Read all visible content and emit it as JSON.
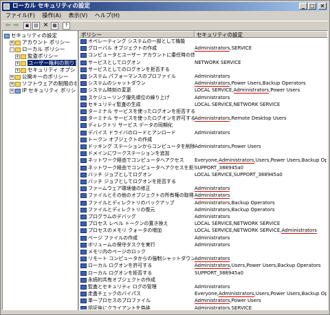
{
  "window": {
    "title": "ローカル セキュリティの設定"
  },
  "menu": [
    "ファイル(F)",
    "操作(A)",
    "表示(V)",
    "ヘルプ(H)"
  ],
  "tree": [
    {
      "label": "セキュリティの設定",
      "level": 0,
      "exp": "",
      "icon": "shield"
    },
    {
      "label": "アカウント ポリシー",
      "level": 1,
      "exp": "+",
      "icon": "folder"
    },
    {
      "label": "ローカル ポリシー",
      "level": 1,
      "exp": "-",
      "icon": "folder"
    },
    {
      "label": "監査ポリシー",
      "level": 2,
      "exp": "+",
      "icon": "folder"
    },
    {
      "label": "ユーザー権利の割り当て",
      "level": 2,
      "exp": "+",
      "icon": "folder",
      "selected": true
    },
    {
      "label": "セキュリティ オプション",
      "level": 2,
      "exp": "+",
      "icon": "folder"
    },
    {
      "label": "公開キーのポリシー",
      "level": 1,
      "exp": "+",
      "icon": "folder"
    },
    {
      "label": "ソフトウェアの制限のポリシー",
      "level": 1,
      "exp": "+",
      "icon": "folder"
    },
    {
      "label": "IP セキュリティ ポリシー (ロー",
      "level": 1,
      "exp": "+",
      "icon": "shield"
    }
  ],
  "columns": {
    "policy": "ポリシー",
    "setting": "セキュリティの設定"
  },
  "rows": [
    {
      "policy": "オペレーティング システムの一部として機能",
      "pre": "",
      "ul": "",
      "post": ""
    },
    {
      "policy": "グローバル オブジェクトの作成",
      "pre": "",
      "ul": "Administrators",
      "post": ",SERVICE"
    },
    {
      "policy": "コンピュータとユーザー アカウントに委任時の信頼を付与",
      "pre": "",
      "ul": "",
      "post": ""
    },
    {
      "policy": "サービスとしてログオン",
      "pre": "NETWORK SERVICE",
      "ul": "",
      "post": ""
    },
    {
      "policy": "サービスとしてのログオンを拒否する",
      "pre": "",
      "ul": "",
      "post": ""
    },
    {
      "policy": "システム パフォーマンスのプロファイル",
      "pre": "",
      "ul": "Administrators",
      "post": ""
    },
    {
      "policy": "システムのシャットダウン",
      "pre": "",
      "ul": "Administrators",
      "post": ",Power Users,Backup Operators"
    },
    {
      "policy": "システム時刻の変更",
      "pre": "LOCAL SERVICE,",
      "ul": "Administrators",
      "post": ",Power Users"
    },
    {
      "policy": "スケジューリング優先順位の繰り上げ",
      "pre": "",
      "ul": "Administrators",
      "post": ""
    },
    {
      "policy": "セキュリティ監査の生成",
      "pre": "LOCAL SERVICE,NETWORK SERVICE",
      "ul": "",
      "post": ""
    },
    {
      "policy": "ターミナル サービスを使ったログオンを拒否する",
      "pre": "",
      "ul": "",
      "post": ""
    },
    {
      "policy": "ターミナル サービスを使ったログオンを許可する",
      "pre": "",
      "ul": "Administrators",
      "post": ",Remote Desktop Users"
    },
    {
      "policy": "ディレクトリ サービス データの同期化",
      "pre": "",
      "ul": "",
      "post": ""
    },
    {
      "policy": "デバイス ドライバのロードとアンロード",
      "pre": "",
      "ul": "Administrators",
      "post": ""
    },
    {
      "policy": "トークン オブジェクトの作成",
      "pre": "",
      "ul": "",
      "post": ""
    },
    {
      "policy": "ドッキング ステーションからコンピュータを削除",
      "pre": "",
      "ul": "Administrators",
      "post": ",Power Users"
    },
    {
      "policy": "ドメインにワークステーションを追加",
      "pre": "",
      "ul": "",
      "post": ""
    },
    {
      "policy": "ネットワーク経由でコンピュータへアクセス",
      "pre": "Everyone,",
      "ul": "Administrators",
      "post": ",Users,Power Users,Backup Operators"
    },
    {
      "policy": "ネットワーク経由でコンピュータへアクセスを拒否する",
      "pre": "SUPPORT_388945a0",
      "ul": "",
      "post": ""
    },
    {
      "policy": "バッチ ジョブとしてログオン",
      "pre": "LOCAL SERVICE,SUPPORT_388945a0",
      "ul": "",
      "post": ""
    },
    {
      "policy": "バッチ ジョブとしてログオンを拒否する",
      "pre": "",
      "ul": "",
      "post": ""
    },
    {
      "policy": "ファームウェア環境値の修正",
      "pre": "",
      "ul": "Administrators",
      "post": ""
    },
    {
      "policy": "ファイルとその他のオブジェクトの所有権の取得",
      "pre": "",
      "ul": "Administrators",
      "post": ""
    },
    {
      "policy": "ファイルとディレクトリのバックアップ",
      "pre": "",
      "ul": "Administrators",
      "post": ",Backup Operators"
    },
    {
      "policy": "ファイルとディレクトリの復元",
      "pre": "",
      "ul": "Administrators",
      "post": ",Backup Operators"
    },
    {
      "policy": "プログラムのデバッグ",
      "pre": "",
      "ul": "Administrators",
      "post": ""
    },
    {
      "policy": "プロセス レベル トークンの置き換え",
      "pre": "LOCAL SERVICE,NETWORK SERVICE",
      "ul": "",
      "post": ""
    },
    {
      "policy": "プロセスのメモリ クォータの増加",
      "pre": "LOCAL SERVICE,NETWORK SERVICE,",
      "ul": "Administrators",
      "post": ""
    },
    {
      "policy": "ページ ファイルの作成",
      "pre": "",
      "ul": "Administrators",
      "post": ""
    },
    {
      "policy": "ボリュームの保守タスクを実行",
      "pre": "",
      "ul": "Administrators",
      "post": ""
    },
    {
      "policy": "メモリ内のページのロック",
      "pre": "",
      "ul": "",
      "post": ""
    },
    {
      "policy": "リモート コンピュータからの強制シャットダウン",
      "pre": "",
      "ul": "Administrators",
      "post": ""
    },
    {
      "policy": "ローカル ログオンを許可する",
      "pre": "",
      "ul": "Administrators",
      "post": ",Users,Power Users,Backup Operators"
    },
    {
      "policy": "ローカル ログオンを拒否する",
      "pre": "SUPPORT_388945a0",
      "ul": "",
      "post": ""
    },
    {
      "policy": "永続的共有オブジェクトの作成",
      "pre": "",
      "ul": "",
      "post": ""
    },
    {
      "policy": "監査とセキュリティ ログの管理",
      "pre": "",
      "ul": "Administrators",
      "post": ""
    },
    {
      "policy": "走査チェックのバイパス",
      "pre": "Everyone,",
      "ul": "Administrators",
      "post": ",Users,Power Users,Backup Operators"
    },
    {
      "policy": "単一プロセスのプロファイル",
      "pre": "",
      "ul": "Administrators",
      "post": ",Power Users"
    },
    {
      "policy": "認証後にクライアントを偽装",
      "pre": "",
      "ul": "Administrators",
      "post": ",SERVICE"
    }
  ]
}
